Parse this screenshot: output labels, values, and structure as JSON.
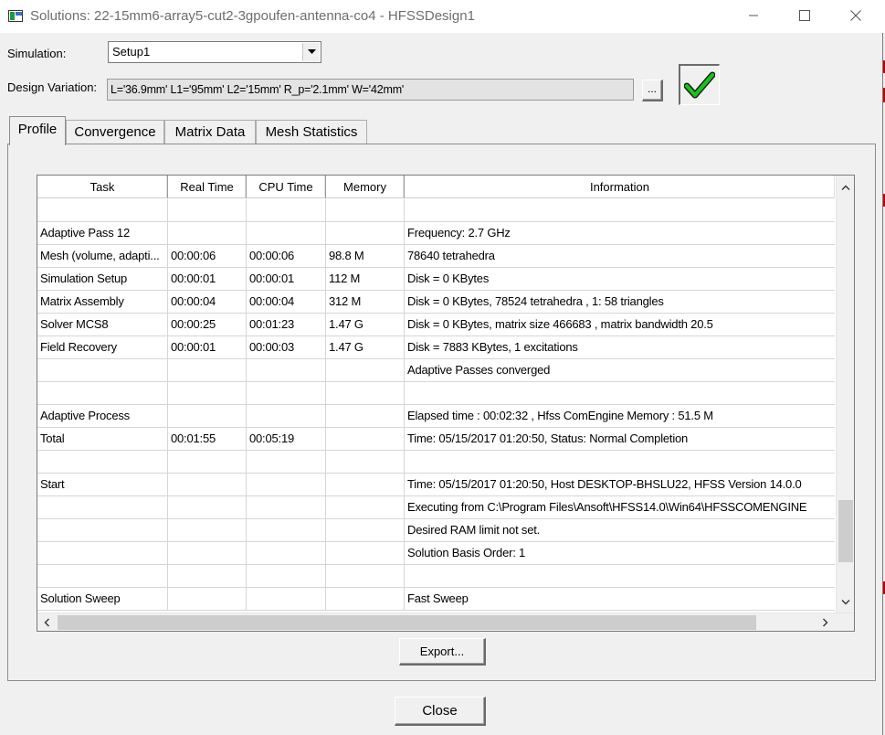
{
  "window": {
    "title": "Solutions: 22-15mm6-array5-cut2-3gpoufen-antenna-co4 - HFSSDesign1"
  },
  "simulation": {
    "label": "Simulation:",
    "value": "Setup1"
  },
  "design_variation": {
    "label": "Design Variation:",
    "value": "L='36.9mm' L1='95mm' L2='15mm' R_p='2.1mm' W='42mm'",
    "browse_label": "..."
  },
  "tabs": [
    {
      "label": "Profile",
      "active": true
    },
    {
      "label": "Convergence",
      "active": false
    },
    {
      "label": "Matrix Data",
      "active": false
    },
    {
      "label": "Mesh Statistics",
      "active": false
    }
  ],
  "table": {
    "columns": [
      "Task",
      "Real Time",
      "CPU Time",
      "Memory",
      "Information"
    ],
    "rows": [
      [
        "",
        "",
        "",
        "",
        ""
      ],
      [
        "Adaptive Pass 12",
        "",
        "",
        "",
        "Frequency: 2.7  GHz"
      ],
      [
        "Mesh (volume, adapti...",
        "00:00:06",
        "00:00:06",
        "98.8 M",
        "78640 tetrahedra"
      ],
      [
        "Simulation Setup",
        "00:00:01",
        "00:00:01",
        "112 M",
        "Disk = 0 KBytes"
      ],
      [
        "Matrix Assembly",
        "00:00:04",
        "00:00:04",
        "312 M",
        "Disk = 0 KBytes, 78524 tetrahedra , 1: 58 triangles"
      ],
      [
        "Solver MCS8",
        "00:00:25",
        "00:01:23",
        "1.47 G",
        "Disk = 0 KBytes, matrix size 466683 , matrix bandwidth  20.5"
      ],
      [
        "Field Recovery",
        "00:00:01",
        "00:00:03",
        "1.47 G",
        "Disk = 7883 KBytes, 1 excitations"
      ],
      [
        "",
        "",
        "",
        "",
        "Adaptive Passes converged"
      ],
      [
        "",
        "",
        "",
        "",
        ""
      ],
      [
        "Adaptive Process",
        "",
        "",
        "",
        "Elapsed time : 00:02:32 , Hfss ComEngine Memory : 51.5 M"
      ],
      [
        "Total",
        "00:01:55",
        "00:05:19",
        "",
        "Time:  05/15/2017 01:20:50, Status: Normal Completion"
      ],
      [
        "",
        "",
        "",
        "",
        ""
      ],
      [
        "Start",
        "",
        "",
        "",
        "Time:  05/15/2017 01:20:50, Host DESKTOP-BHSLU22, HFSS Version 14.0.0"
      ],
      [
        "",
        "",
        "",
        "",
        "Executing from C:\\Program Files\\Ansoft\\HFSS14.0\\Win64\\HFSSCOMENGINE"
      ],
      [
        "",
        "",
        "",
        "",
        "Desired RAM limit not set."
      ],
      [
        "",
        "",
        "",
        "",
        "Solution Basis Order: 1"
      ],
      [
        "",
        "",
        "",
        "",
        ""
      ],
      [
        "Solution Sweep",
        "",
        "",
        "",
        "Fast Sweep"
      ]
    ]
  },
  "buttons": {
    "export_label": "Export...",
    "close_label": "Close"
  },
  "icons": {
    "app": "hfss-window-icon",
    "status": "green-check-icon"
  },
  "colors": {
    "check_green": "#19c219",
    "title_text": "#6d6d6d"
  }
}
